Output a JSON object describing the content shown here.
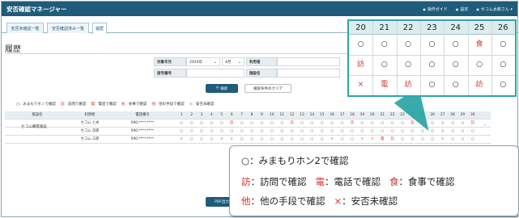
{
  "app": {
    "title": "安否確認マネージャー",
    "nav": [
      "操作ガイド",
      "設定",
      "セコム太郎"
    ],
    "user_suffix": "さん ▾"
  },
  "tabs": [
    "安否未確認一覧",
    "安否確認済み一覧",
    "履歴"
  ],
  "page_title": "履歴",
  "form": {
    "target_month_label": "対象年月",
    "year_value": "2020年",
    "month_value": "4月",
    "user_label": "利用者",
    "residence_label": "居宅番号",
    "facility_label": "施設名",
    "search_button": "検索",
    "clear_button": "検索条件のクリア"
  },
  "legend_line": {
    "circle": "○：みまもりホンで確認",
    "visit": "訪",
    "visit_text": "：訪問で確認",
    "phone": "電",
    "phone_text": "：電話で確認",
    "meal": "食",
    "meal_text": "：食事で確認",
    "other": "他",
    "other_text": "：他の手段で確認",
    "unconfirmed": "×",
    "unconfirmed_text": "：安否未確認"
  },
  "table": {
    "headers": [
      "施設名",
      "利用者",
      "電話番号"
    ],
    "days": [
      "1",
      "2",
      "3",
      "4",
      "5",
      "6",
      "7",
      "8",
      "9",
      "10",
      "11",
      "12",
      "13",
      "14",
      "15",
      "16",
      "17",
      "18",
      "19",
      "20",
      "21",
      "22",
      "23",
      "24",
      "25",
      "26",
      "27",
      "28",
      "29",
      "30"
    ],
    "facility": "セコム幕張施設",
    "rows": [
      {
        "name": "セコム とめ",
        "phone": "090-****-****",
        "marks": [
          "○",
          "○",
          "○",
          "○",
          "○",
          "訪",
          "○",
          "○",
          "○",
          "○",
          "○",
          "訪",
          "○",
          "○",
          "○",
          "○",
          "○",
          "訪",
          "○",
          "○",
          "○",
          "○",
          "○",
          "訪",
          "○",
          "○",
          "○",
          "○",
          "○",
          "訪"
        ]
      },
      {
        "name": "セコム 次郎",
        "phone": "090-****-****",
        "marks": [
          "○",
          "○",
          "○",
          "○",
          "○",
          "○",
          "○",
          "○",
          "○",
          "○",
          "○",
          "○",
          "○",
          "○",
          "○",
          "○",
          "○",
          "○",
          "○",
          "○",
          "○",
          "○",
          "○",
          "○",
          "○",
          "○",
          "○",
          "○",
          "○",
          "○"
        ]
      },
      {
        "name": "セコム 三郎",
        "phone": "090-****-****",
        "marks": [
          "×",
          "○",
          "○",
          "○",
          "×",
          "×",
          "○",
          "○",
          "○",
          "○",
          "○",
          "○",
          "○",
          "○",
          "○",
          "×",
          "○",
          "○",
          "×",
          "×",
          "電",
          "訪",
          "○",
          "○",
          "○",
          "○",
          "×",
          "○",
          "○",
          "○"
        ]
      }
    ]
  },
  "pdf_button": "PDF出力",
  "zoom": {
    "days": [
      "20",
      "21",
      "22",
      "23",
      "24",
      "25",
      "26"
    ],
    "rows": [
      [
        "○",
        "○",
        "○",
        "○",
        "○",
        "食",
        "○"
      ],
      [
        "訪",
        "○",
        "○",
        "○",
        "○",
        "○",
        "○"
      ],
      [
        "×",
        "電",
        "訪",
        "○",
        "○",
        "訪",
        "○"
      ]
    ]
  },
  "bubble": {
    "line1": "○：みまもりホン2で確認",
    "visit": "訪",
    "visit_text": "：訪問で確認",
    "phone": "電",
    "phone_text": "：電話で確認",
    "meal": "食",
    "meal_text": "：食事で確認",
    "other": "他",
    "other_text": "：他の手段で確認",
    "unconfirmed": "×",
    "unconfirmed_text": "：安否未確認"
  },
  "colors": {
    "header": "#1f5b7a",
    "accent": "#2fa6a6",
    "red_mark": "#d9302a"
  }
}
